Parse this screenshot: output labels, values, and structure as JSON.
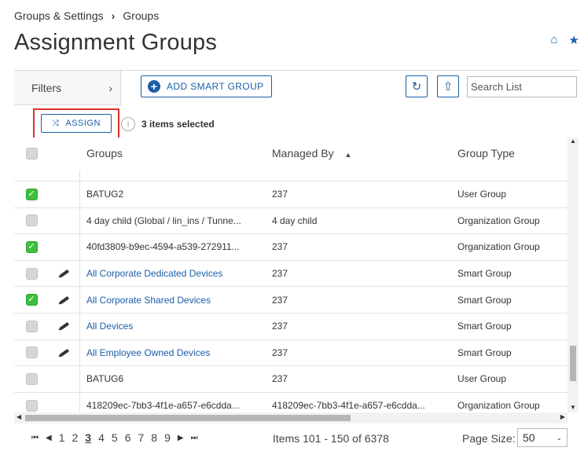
{
  "breadcrumb": {
    "root": "Groups & Settings",
    "current": "Groups"
  },
  "page_title": "Assignment Groups",
  "filters": {
    "label": "Filters"
  },
  "toolbar": {
    "add_smart_group": "ADD SMART GROUP",
    "search_placeholder": "Search List"
  },
  "assign": {
    "label": "ASSIGN",
    "selected_text": "3 items selected"
  },
  "columns": {
    "groups": "Groups",
    "managed_by": "Managed By",
    "group_type": "Group Type",
    "sort": "ascending"
  },
  "rows": [
    {
      "name": "BATUG2",
      "managed_by": "237",
      "type": "User Group",
      "checked": true,
      "editable": false,
      "link": false
    },
    {
      "name": "4 day child (Global / lin_ins / Tunne...",
      "managed_by": "4 day child",
      "type": "Organization Group",
      "checked": false,
      "editable": false,
      "link": false
    },
    {
      "name": "40fd3809-b9ec-4594-a539-272911...",
      "managed_by": "237",
      "type": "Organization Group",
      "checked": true,
      "editable": false,
      "link": false
    },
    {
      "name": "All Corporate Dedicated Devices",
      "managed_by": "237",
      "type": "Smart Group",
      "checked": false,
      "editable": true,
      "link": true
    },
    {
      "name": "All Corporate Shared Devices",
      "managed_by": "237",
      "type": "Smart Group",
      "checked": true,
      "editable": true,
      "link": true
    },
    {
      "name": "All Devices",
      "managed_by": "237",
      "type": "Smart Group",
      "checked": false,
      "editable": true,
      "link": true
    },
    {
      "name": "All Employee Owned Devices",
      "managed_by": "237",
      "type": "Smart Group",
      "checked": false,
      "editable": true,
      "link": true
    },
    {
      "name": "BATUG6",
      "managed_by": "237",
      "type": "User Group",
      "checked": false,
      "editable": false,
      "link": false
    },
    {
      "name": "418209ec-7bb3-4f1e-a657-e6cdda...",
      "managed_by": "418209ec-7bb3-4f1e-a657-e6cdda...",
      "type": "Organization Group",
      "checked": false,
      "editable": false,
      "link": false
    }
  ],
  "pagination": {
    "pages": [
      "1",
      "2",
      "3",
      "4",
      "5",
      "6",
      "7",
      "8",
      "9"
    ],
    "current_page": "3",
    "items_range": "Items 101 - 150 of 6378",
    "page_size_label": "Page Size:",
    "page_size": "50"
  },
  "colors": {
    "accent": "#1a5ea8",
    "checked": "#3fbf3f",
    "highlight": "#e0302a"
  }
}
